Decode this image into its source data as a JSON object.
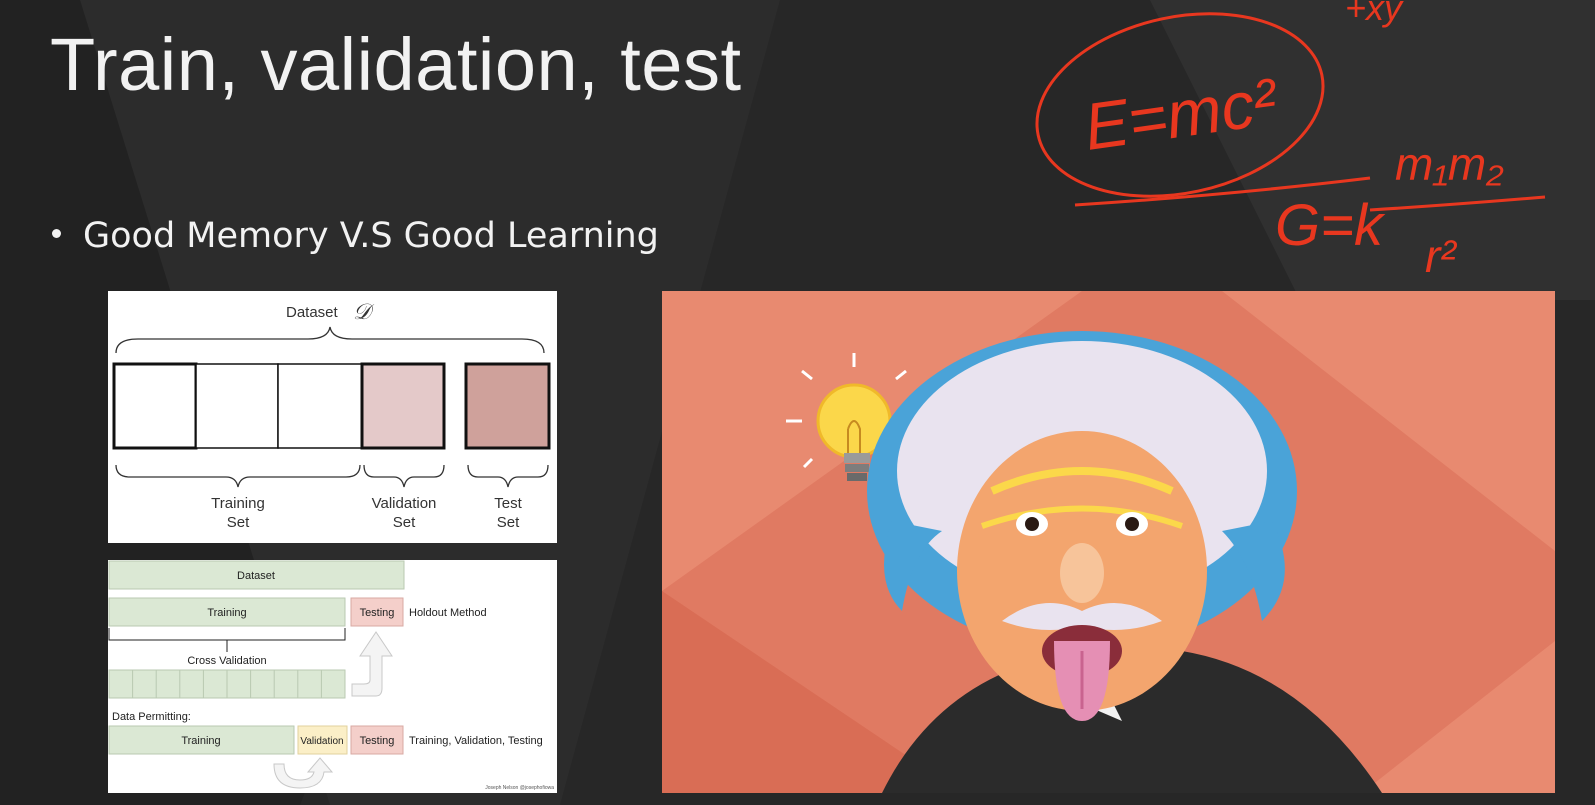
{
  "slide": {
    "title": "Train, validation, test",
    "bullet": "Good Memory V.S Good Learning"
  },
  "annotations": {
    "formula_1": "E=mc²",
    "formula_2_left": "G=k",
    "formula_2_num": "m₁m₂",
    "formula_2_den": "r²",
    "corner_scribble": "+xy",
    "ink_color": "#e8371f"
  },
  "dataset_split_figure": {
    "title": "Dataset",
    "symbol": "𝒟",
    "labels": [
      {
        "line1": "Training",
        "line2": "Set"
      },
      {
        "line1": "Validation",
        "line2": "Set"
      },
      {
        "line1": "Test",
        "line2": "Set"
      }
    ],
    "validation_color": "#e4c9c9",
    "test_color": "#cfa19b"
  },
  "holdout_figure": {
    "dataset": "Dataset",
    "training": "Training",
    "testing": "Testing",
    "holdout_method": "Holdout Method",
    "cross_validation": "Cross Validation",
    "data_permitting": "Data Permitting:",
    "training_2": "Training",
    "validation": "Validation",
    "testing_2": "Testing",
    "tvt_label": "Training, Validation, Testing",
    "credit": "Joseph Nelson @josephofiowa",
    "green": "#dbe8d4",
    "pink": "#f4cfca",
    "yellow": "#fbefc7"
  },
  "illustration": {
    "subject": "einstein-cartoon",
    "background": "#e07a62"
  }
}
